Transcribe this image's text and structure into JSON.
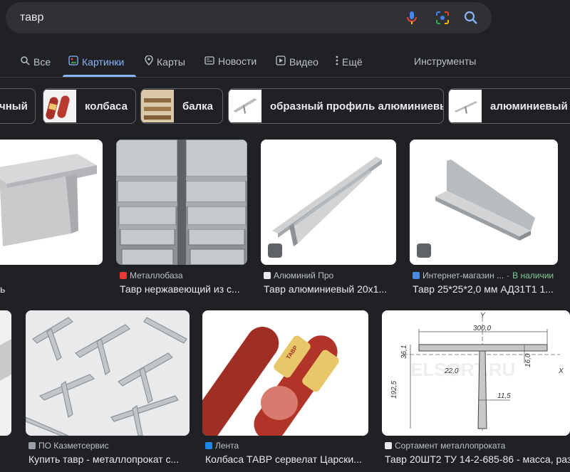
{
  "search": {
    "query": "тавр"
  },
  "tabs": [
    {
      "label": "Все"
    },
    {
      "label": "Картинки"
    },
    {
      "label": "Карты"
    },
    {
      "label": "Новости"
    },
    {
      "label": "Видео"
    },
    {
      "label": "Ещё"
    }
  ],
  "tools_label": "Инструменты",
  "chips": [
    {
      "label": "чный"
    },
    {
      "label": "колбаса"
    },
    {
      "label": "балка"
    },
    {
      "label": "образный профиль алюминиевый"
    },
    {
      "label": "алюминиевый та"
    }
  ],
  "results_row1": [
    {
      "source": "",
      "title": "ь"
    },
    {
      "source": "Металлобаза",
      "title": "Тавр нержавеющий из с..."
    },
    {
      "source": "Алюминий Про",
      "title": "Тавр алюминиевый 20х1..."
    },
    {
      "source": "Интернет-магазин ...",
      "availability": "В наличии",
      "title": "Тавр 25*25*2,0 мм АД31Т1 1..."
    }
  ],
  "results_row2": [
    {
      "source": "ПО Казметсервис",
      "title": "Купить тавр - металлопрокат с..."
    },
    {
      "source": "Лента",
      "title": "Колбаса ТАВР сервелат Царски..."
    },
    {
      "source": "Сортамент металлопроката",
      "title": "Тавр 20ШТ2 ТУ 14-2-685-86 - масса, раз"
    }
  ],
  "drawing": {
    "axis_y": "Y",
    "axis_x": "X",
    "dim_width": "300,0",
    "dim_flange": "16,0",
    "dim_a": "36,1",
    "dim_r": "22,0",
    "dim_height": "192,5",
    "dim_web": "11,5",
    "watermark": "ELSORT.RU"
  },
  "sausage_label": "ТАВР",
  "colors": {
    "background": "#202124",
    "accent": "#8ab4f8",
    "available": "#81c995",
    "mic_blue": "#4285f4",
    "mic_red": "#ea4335"
  }
}
